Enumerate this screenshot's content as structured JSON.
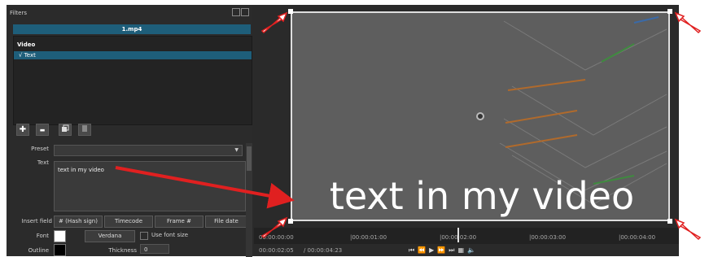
{
  "filters_panel": {
    "title": "Filters",
    "clip_name": "1.mp4",
    "category": "Video",
    "filter_item": "√ Text"
  },
  "toolbar": {
    "add_icon": "plus-icon",
    "remove_icon": "minus-icon",
    "copy_icon": "copy-icon",
    "paste_icon": "paste-icon",
    "add": "✚",
    "remove": "▬"
  },
  "form": {
    "preset_label": "Preset",
    "preset_value": "",
    "text_label": "Text",
    "text_value": "text in my video",
    "insert_field_label": "Insert field",
    "insert_buttons": [
      "# (Hash sign)",
      "Timecode",
      "Frame #",
      "File date"
    ],
    "font_label": "Font",
    "font_name": "Verdana",
    "use_font_size_label": "Use font size",
    "outline_label": "Outline",
    "thickness_label": "Thickness",
    "thickness_value": "0"
  },
  "preview": {
    "overlay_text": "text in my video"
  },
  "timeline": {
    "ticks": [
      "00:00:00:00",
      "|00:00:01:00",
      "|00:00:02:00",
      "|00:00:03:00",
      "|00:00:04:00"
    ],
    "position": "00:00:02:05",
    "duration": "/ 00:00:04:23"
  },
  "colors": {
    "accent": "#1e5e7a",
    "arrow": "#e02020",
    "font_swatch": "#ffffff",
    "outline_swatch": "#000000"
  }
}
